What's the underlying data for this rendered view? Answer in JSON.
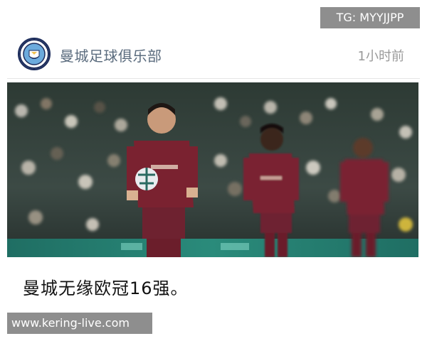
{
  "watermark_top": "TG: MYYJJPP",
  "header": {
    "account_name": "曼城足球俱乐部",
    "timestamp": "1小时前",
    "avatar_icon": "manchester-city-crest-icon"
  },
  "post": {
    "caption": "曼城无缘欧冠16强。",
    "photo_subject": "football players in maroon kits walking on pitch with stadium crowd"
  },
  "watermark_bottom": "www.kering-live.com",
  "colors": {
    "account_name": "#5a6b7d",
    "timestamp": "#9a9a9a",
    "watermark_bg": "#8e8e8e",
    "kit_maroon": "#7a2230",
    "crest_navy": "#1c2c5b",
    "crest_sky": "#6cabdd"
  }
}
